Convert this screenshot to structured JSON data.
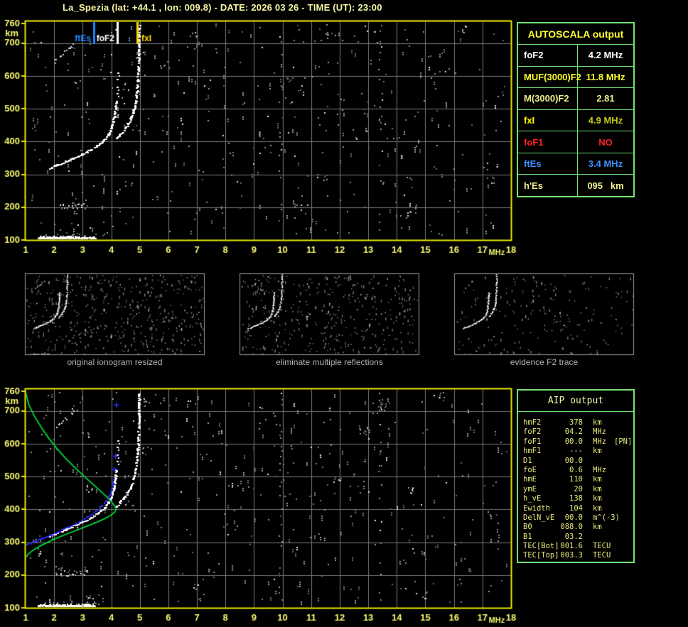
{
  "title": "La_Spezia (lat: +44.1 , lon: 009.8) - DATE: 2026 03 26 - TIME (UT): 23:00",
  "colors": {
    "title_yellow": "#f6f6a6",
    "axis_label": "#f8f870",
    "grid": "#7a7a7a",
    "frame": "#e8e800",
    "trace_white": "#ffffff",
    "profile_green": "#00d836",
    "restored_blue": "#2a2aff",
    "table_border": "#74e274",
    "caption_gray": "#b2b2b2",
    "thumb_border": "#9a9a9a"
  },
  "autoscala": {
    "title": "AUTOSCALA output",
    "rows": [
      {
        "label": "foF2",
        "value": "4.2 MHz",
        "color": "#ffffff",
        "value_color": "#ffffff"
      },
      {
        "label": "MUF(3000)F2",
        "value": "11.8 MHz",
        "color": "#ffff28",
        "value_color": "#ffff28"
      },
      {
        "label": "M(3000)F2",
        "value": "2.81",
        "color": "#f0f090",
        "value_color": "#f0f090"
      },
      {
        "label": "fxI",
        "value": "4.9 MHz",
        "color": "#ffff00",
        "value_color": "#c6c61c"
      },
      {
        "label": "foF1",
        "value": "NO",
        "color": "#ff2424",
        "value_color": "#ff2424"
      },
      {
        "label": "ftEs",
        "value": "3.4 MHz",
        "color": "#3f8fff",
        "value_color": "#3f8fff"
      },
      {
        "label": "h'Es",
        "value": "095   km",
        "color": "#f0f090",
        "value_color": "#f0f090"
      }
    ]
  },
  "aip": {
    "title": "AIP output",
    "rows": [
      {
        "label": "hmF2",
        "value": "378",
        "unit": "km",
        "note": ""
      },
      {
        "label": "foF2",
        "value": "04.2",
        "unit": "MHz",
        "note": ""
      },
      {
        "label": "foF1",
        "value": "00.0",
        "unit": "MHz",
        "note": "[PN]"
      },
      {
        "label": "hmF1",
        "value": "---",
        "unit": "km",
        "note": ""
      },
      {
        "label": "D1",
        "value": "00.0",
        "unit": "",
        "note": ""
      },
      {
        "label": "foE",
        "value": "0.6",
        "unit": "MHz",
        "note": ""
      },
      {
        "label": "hmE",
        "value": "110",
        "unit": "km",
        "note": ""
      },
      {
        "label": "ymE",
        "value": "20",
        "unit": "km",
        "note": ""
      },
      {
        "label": "h_vE",
        "value": "138",
        "unit": "km",
        "note": ""
      },
      {
        "label": "Ewidth",
        "value": "104",
        "unit": "km",
        "note": ""
      },
      {
        "label": "DelN_vE",
        "value": "00.0",
        "unit": "m^(-3)",
        "note": ""
      },
      {
        "label": "B0",
        "value": "088.0",
        "unit": "km",
        "note": ""
      },
      {
        "label": "B1",
        "value": "03.2",
        "unit": "",
        "note": ""
      },
      {
        "label": "TEC[Bot]",
        "value": "001.6",
        "unit": "TECU",
        "note": ""
      },
      {
        "label": "TEC[Top]",
        "value": "003.3",
        "unit": "TECU",
        "note": ""
      }
    ]
  },
  "thumbnails": [
    {
      "caption": "original ionogram resized"
    },
    {
      "caption": "eliminate multiple reflections"
    },
    {
      "caption": "evidence F2 trace"
    }
  ],
  "chart_data": [
    {
      "id": "main_ionogram",
      "type": "scatter",
      "xlabel": "MHz",
      "ylabel": "km",
      "xlim": [
        1,
        18
      ],
      "ylim": [
        100,
        760
      ],
      "x_ticks": [
        1,
        2,
        3,
        4,
        5,
        6,
        7,
        8,
        9,
        10,
        11,
        12,
        13,
        14,
        15,
        16,
        17,
        18
      ],
      "y_ticks": [
        100,
        200,
        300,
        400,
        500,
        600,
        700,
        760
      ],
      "grid": true,
      "markers": [
        {
          "name": "ftEs",
          "f": 3.4,
          "color": "#1f86ff",
          "label_side": "left"
        },
        {
          "name": "foF2",
          "f": 4.2,
          "color": "#ffffff",
          "label_side": "left"
        },
        {
          "name": "fxI",
          "f": 4.9,
          "color": "#ffd900",
          "label_side": "right"
        }
      ],
      "traces": {
        "f2_ordinary": [
          [
            1.85,
            318
          ],
          [
            2.1,
            327
          ],
          [
            2.4,
            338
          ],
          [
            2.7,
            349
          ],
          [
            3.0,
            361
          ],
          [
            3.3,
            374
          ],
          [
            3.55,
            388
          ],
          [
            3.75,
            403
          ],
          [
            3.9,
            420
          ],
          [
            4.0,
            438
          ],
          [
            4.07,
            458
          ],
          [
            4.12,
            478
          ],
          [
            4.16,
            500
          ],
          [
            4.18,
            522
          ]
        ],
        "f2_ordinary_sparse": [
          [
            4.2,
            545
          ],
          [
            4.21,
            565
          ],
          [
            4.22,
            588
          ],
          [
            4.23,
            608
          ]
        ],
        "f2_extraordinary": [
          [
            4.18,
            408
          ],
          [
            4.3,
            420
          ],
          [
            4.45,
            435
          ],
          [
            4.58,
            452
          ],
          [
            4.7,
            472
          ],
          [
            4.79,
            495
          ],
          [
            4.86,
            522
          ],
          [
            4.9,
            552
          ],
          [
            4.93,
            585
          ],
          [
            4.95,
            620
          ],
          [
            4.96,
            655
          ],
          [
            4.97,
            690
          ],
          [
            4.975,
            722
          ],
          [
            4.98,
            752
          ]
        ],
        "es_layer": {
          "f_range": [
            1.45,
            3.45
          ],
          "km_range": [
            102,
            113
          ]
        },
        "es_second_hop": {
          "f_range": [
            2.2,
            3.15
          ],
          "km_range": [
            196,
            216
          ]
        },
        "f_multiple": [
          [
            2.0,
            643
          ],
          [
            2.2,
            660
          ],
          [
            2.4,
            675
          ],
          [
            2.6,
            691
          ],
          [
            2.75,
            703
          ]
        ]
      },
      "interference_columns_mhz": [
        9.9,
        13.4
      ]
    },
    {
      "id": "profile_ionogram",
      "type": "scatter",
      "xlabel": "MHz",
      "ylabel": "km",
      "xlim": [
        1,
        18
      ],
      "ylim": [
        100,
        760
      ],
      "x_ticks": [
        1,
        2,
        3,
        4,
        5,
        6,
        7,
        8,
        9,
        10,
        11,
        12,
        13,
        14,
        15,
        16,
        17,
        18
      ],
      "y_ticks": [
        100,
        200,
        300,
        400,
        500,
        600,
        700,
        760
      ],
      "grid": true,
      "markers": [],
      "traces": {
        "f2_ordinary": [
          [
            1.85,
            318
          ],
          [
            2.1,
            327
          ],
          [
            2.4,
            338
          ],
          [
            2.7,
            349
          ],
          [
            3.0,
            361
          ],
          [
            3.3,
            374
          ],
          [
            3.55,
            388
          ],
          [
            3.75,
            403
          ],
          [
            3.9,
            420
          ],
          [
            4.0,
            438
          ],
          [
            4.07,
            458
          ],
          [
            4.12,
            478
          ],
          [
            4.16,
            500
          ],
          [
            4.18,
            522
          ]
        ],
        "f2_ordinary_sparse": [
          [
            4.2,
            545
          ],
          [
            4.21,
            565
          ],
          [
            4.22,
            588
          ],
          [
            4.23,
            608
          ]
        ],
        "f2_extraordinary": [
          [
            4.18,
            408
          ],
          [
            4.3,
            420
          ],
          [
            4.45,
            435
          ],
          [
            4.58,
            452
          ],
          [
            4.7,
            472
          ],
          [
            4.79,
            495
          ],
          [
            4.86,
            522
          ],
          [
            4.9,
            552
          ],
          [
            4.93,
            585
          ],
          [
            4.95,
            620
          ],
          [
            4.96,
            655
          ],
          [
            4.97,
            690
          ],
          [
            4.975,
            722
          ],
          [
            4.98,
            752
          ]
        ],
        "es_layer": {
          "f_range": [
            1.45,
            3.45
          ],
          "km_range": [
            102,
            113
          ]
        },
        "es_second_hop": {
          "f_range": [
            2.2,
            3.15
          ],
          "km_range": [
            196,
            216
          ]
        },
        "f_multiple": [
          [
            2.0,
            643
          ],
          [
            2.2,
            660
          ],
          [
            2.4,
            675
          ],
          [
            2.6,
            691
          ],
          [
            2.75,
            703
          ]
        ]
      },
      "interference_columns_mhz": [
        9.9,
        13.4
      ],
      "profile_curve": [
        [
          1.0,
          760
        ],
        [
          1.1,
          722
        ],
        [
          1.3,
          685
        ],
        [
          1.55,
          650
        ],
        [
          1.8,
          618
        ],
        [
          2.1,
          585
        ],
        [
          2.4,
          556
        ],
        [
          2.7,
          530
        ],
        [
          3.0,
          505
        ],
        [
          3.3,
          481
        ],
        [
          3.6,
          458
        ],
        [
          3.85,
          438
        ],
        [
          4.02,
          422
        ],
        [
          4.12,
          410
        ],
        [
          4.17,
          401
        ],
        [
          4.13,
          392
        ],
        [
          4.0,
          383
        ],
        [
          3.8,
          373
        ],
        [
          3.5,
          361
        ],
        [
          3.15,
          349
        ],
        [
          2.8,
          337
        ],
        [
          2.45,
          325
        ],
        [
          2.1,
          313
        ],
        [
          1.8,
          301
        ],
        [
          1.5,
          288
        ],
        [
          1.25,
          275
        ],
        [
          1.08,
          263
        ],
        [
          1.0,
          252
        ]
      ],
      "restored_trace": [
        [
          1.0,
          290
        ],
        [
          1.3,
          300
        ],
        [
          1.6,
          311
        ],
        [
          1.9,
          322
        ],
        [
          2.2,
          334
        ],
        [
          2.5,
          346
        ],
        [
          2.8,
          358
        ],
        [
          3.05,
          370
        ],
        [
          3.3,
          383
        ],
        [
          3.5,
          396
        ],
        [
          3.68,
          410
        ],
        [
          3.82,
          424
        ],
        [
          3.92,
          440
        ],
        [
          4.0,
          456
        ],
        [
          4.05,
          472
        ],
        [
          4.08,
          490
        ]
      ],
      "restored_sparse": [
        [
          4.12,
          522
        ],
        [
          4.15,
          562
        ],
        [
          4.18,
          718
        ]
      ]
    }
  ]
}
